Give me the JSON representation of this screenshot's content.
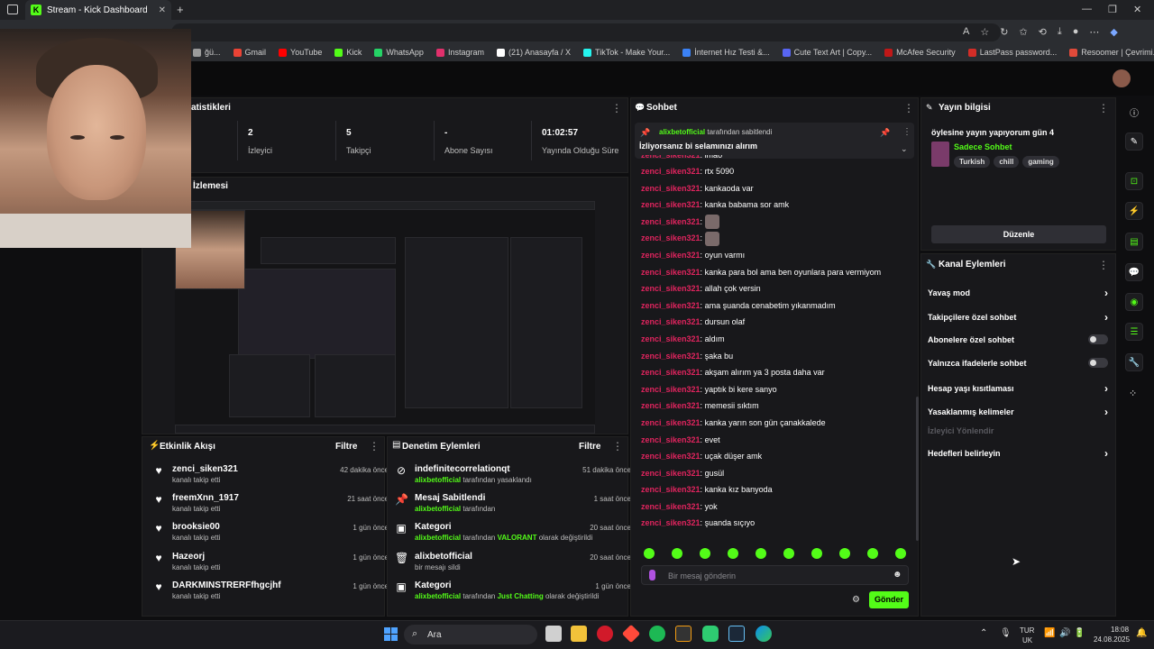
{
  "browser": {
    "tab_title": "Stream - Kick Dashboard",
    "new_tab": "+",
    "url_fragment": "m",
    "bookmarks": [
      {
        "label": "ğü...",
        "color": "#9b9b9b"
      },
      {
        "label": "Gmail",
        "color": "#ea4335"
      },
      {
        "label": "YouTube",
        "color": "#ff0000"
      },
      {
        "label": "Kick",
        "color": "#53fc18"
      },
      {
        "label": "WhatsApp",
        "color": "#25d366"
      },
      {
        "label": "Instagram",
        "color": "#e1306c"
      },
      {
        "label": "(21) Anasayfa / X",
        "color": "#ffffff"
      },
      {
        "label": "TikTok - Make Your...",
        "color": "#25f4ee"
      },
      {
        "label": "İnternet Hız Testi &...",
        "color": "#3b82f6"
      },
      {
        "label": "Cute Text Art | Copy...",
        "color": "#5865f2"
      },
      {
        "label": "McAfee Security",
        "color": "#c01818"
      },
      {
        "label": "LastPass password...",
        "color": "#d32d27"
      },
      {
        "label": "Resoomer | Çevrimi...",
        "color": "#e04a3a"
      }
    ]
  },
  "stats": {
    "section_title": "atistikleri",
    "items": [
      {
        "value": "2",
        "label": "İzleyici"
      },
      {
        "value": "5",
        "label": "Takipçi"
      },
      {
        "value": "-",
        "label": "Abone Sayısı"
      },
      {
        "value": "01:02:57",
        "label": "Yayında Olduğu Süre"
      }
    ]
  },
  "preview": {
    "title": "İzlemesi"
  },
  "activity": {
    "title": "Etkinlik Akışı",
    "filter": "Filtre",
    "items": [
      {
        "name": "zenci_siken321",
        "sub": "kanalı takip etti",
        "time": "42 dakika önce"
      },
      {
        "name": "freemXnn_1917",
        "sub": "kanalı takip etti",
        "time": "21 saat önce"
      },
      {
        "name": "brooksie00",
        "sub": "kanalı takip etti",
        "time": "1 gün önce"
      },
      {
        "name": "Hazeorj",
        "sub": "kanalı takip etti",
        "time": "1 gün önce"
      },
      {
        "name": "DARKMINSTRERFfhgcjhf",
        "sub": "kanalı takip etti",
        "time": "1 gün önce"
      }
    ]
  },
  "moderation": {
    "title": "Denetim Eylemleri",
    "filter": "Filtre",
    "items": [
      {
        "name": "indefinitecorrelationqt",
        "user": "alixbetofficial",
        "rest": " tarafından yasaklandı",
        "time": "51 dakika önce"
      },
      {
        "name": "Mesaj Sabitlendi",
        "user": "alixbetofficial",
        "rest": " tarafından",
        "time": "1 saat önce"
      },
      {
        "name": "Kategori",
        "user": "alixbetofficial",
        "rest": " tarafından ",
        "hl": "VALORANT",
        "rest2": " olarak değiştirildi",
        "time": "20 saat önce"
      },
      {
        "name": "alixbetofficial",
        "user": "",
        "rest": "bir mesajı sildi",
        "time": "20 saat önce"
      },
      {
        "name": "Kategori",
        "user": "alixbetofficial",
        "rest": " tarafından ",
        "hl": "Just Chatting",
        "rest2": " olarak değiştirildi",
        "time": "1 gün önce"
      }
    ]
  },
  "chat": {
    "title": "Sohbet",
    "pinned_by_user": "alixbetofficial",
    "pinned_by_text": "tarafından sabitlendi",
    "pinned_message": "İzliyorsanız bi selamınızı alırım",
    "user": "zenci_siken321",
    "messages": [
      "lmao",
      "rtx 5090",
      "kankaoda var",
      "kanka babama sor amk",
      "",
      "",
      "oyun varmı",
      "kanka para bol ama ben oyunlara para vermiyom",
      "allah çok versin",
      "ama şuanda cenabetim yıkanmadım",
      "dursun olaf",
      "aldım",
      "şaka bu",
      "akşam alırım ya 3 posta daha var",
      "yaptık bi kere sanyo",
      "memesii sıktım",
      "kanka yarın son gün çanakkalede",
      "evet",
      "uçak düşer amk",
      "gusül",
      "kanka kız banyoda",
      "yok",
      "şuanda sıçıyo"
    ],
    "input_placeholder": "Bir mesaj gönderin",
    "send_label": "Gönder"
  },
  "stream_info": {
    "title": "Yayın bilgisi",
    "stream_title": "öylesine yayın yapıyorum gün 4",
    "category": "Sadece Sohbet",
    "tags": [
      "Turkish",
      "chill",
      "gaming"
    ],
    "edit_label": "Düzenle"
  },
  "channel_actions": {
    "title": "Kanal Eylemleri",
    "items": [
      {
        "label": "Yavaş mod",
        "kind": "chevron"
      },
      {
        "label": "Takipçilere özel sohbet",
        "kind": "chevron"
      },
      {
        "label": "Abonelere özel sohbet",
        "kind": "toggle"
      },
      {
        "label": "Yalnızca ifadelerle sohbet",
        "kind": "toggle"
      },
      {
        "label": "Hesap yaşı kısıtlaması",
        "kind": "chevron"
      },
      {
        "label": "Yasaklanmış kelimeler",
        "kind": "chevron"
      },
      {
        "label": "İzleyici Yönlendir",
        "kind": "disabled"
      },
      {
        "label": "Hedefleri belirleyin",
        "kind": "chevron"
      }
    ]
  },
  "taskbar": {
    "search": "Ara",
    "lang_top": "TUR",
    "lang_bottom": "UK",
    "time": "18:08",
    "date": "24.08.2025"
  }
}
